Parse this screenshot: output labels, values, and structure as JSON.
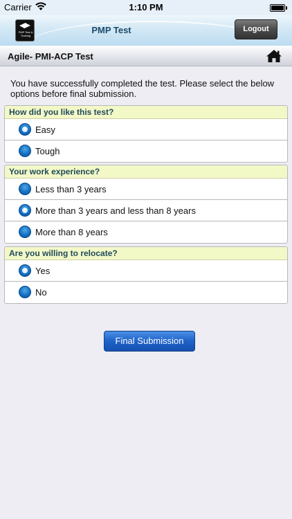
{
  "status_bar": {
    "carrier": "Carrier",
    "time": "1:10 PM",
    "icons": [
      "wifi-icon",
      "battery-icon"
    ]
  },
  "app_header": {
    "title": "PMP Test",
    "logout_label": "Logout",
    "logo_text": "PMP Test & Training"
  },
  "page": {
    "title": "Agile- PMI-ACP Test",
    "home_icon": "home-icon",
    "intro": "You have successfully completed the test. Please select the below options before final submission."
  },
  "questions": [
    {
      "label": "How did you like this test?",
      "options": [
        {
          "label": "Easy",
          "selected": true
        },
        {
          "label": "Tough",
          "selected": false
        }
      ]
    },
    {
      "label": "Your work experience?",
      "options": [
        {
          "label": "Less than 3 years",
          "selected": false
        },
        {
          "label": "More than 3 years and less than 8 years",
          "selected": true
        },
        {
          "label": "More than 8 years",
          "selected": false
        }
      ]
    },
    {
      "label": "Are you willing to relocate?",
      "options": [
        {
          "label": "Yes",
          "selected": true
        },
        {
          "label": "No",
          "selected": false
        }
      ]
    }
  ],
  "submit_label": "Final Submission",
  "colors": {
    "question_header_bg": "#f3f8c7",
    "radio_blue": "#1570c4",
    "submit_blue": "#1f62c9"
  }
}
